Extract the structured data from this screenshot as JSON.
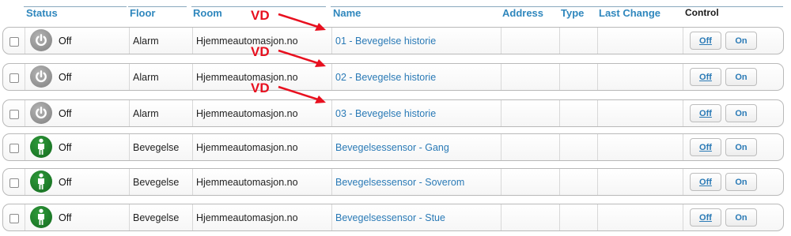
{
  "header": {
    "status": "Status",
    "floor": "Floor",
    "room": "Room",
    "name": "Name",
    "address": "Address",
    "type": "Type",
    "last_change": "Last Change",
    "control": "Control"
  },
  "annotation": {
    "label": "VD",
    "color": "#e8101f"
  },
  "rows": [
    {
      "status": "Off",
      "icon": "power-icon",
      "floor": "Alarm",
      "room": "Hjemmeautomasjon.no",
      "name": "01 - Bevegelse historie",
      "address": "",
      "type": "",
      "last_change": "",
      "off_label": "Off",
      "on_label": "On",
      "annotated": true
    },
    {
      "status": "Off",
      "icon": "power-icon",
      "floor": "Alarm",
      "room": "Hjemmeautomasjon.no",
      "name": "02 - Bevegelse historie",
      "address": "",
      "type": "",
      "last_change": "",
      "off_label": "Off",
      "on_label": "On",
      "annotated": true
    },
    {
      "status": "Off",
      "icon": "power-icon",
      "floor": "Alarm",
      "room": "Hjemmeautomasjon.no",
      "name": "03 - Bevegelse historie",
      "address": "",
      "type": "",
      "last_change": "",
      "off_label": "Off",
      "on_label": "On",
      "annotated": true
    },
    {
      "status": "Off",
      "icon": "person-icon",
      "floor": "Bevegelse",
      "room": "Hjemmeautomasjon.no",
      "name": "Bevegelsessensor - Gang",
      "address": "",
      "type": "",
      "last_change": "",
      "off_label": "Off",
      "on_label": "On",
      "annotated": false
    },
    {
      "status": "Off",
      "icon": "person-icon",
      "floor": "Bevegelse",
      "room": "Hjemmeautomasjon.no",
      "name": "Bevegelsessensor - Soverom",
      "address": "",
      "type": "",
      "last_change": "",
      "off_label": "Off",
      "on_label": "On",
      "annotated": false
    },
    {
      "status": "Off",
      "icon": "person-icon",
      "floor": "Bevegelse",
      "room": "Hjemmeautomasjon.no",
      "name": "Bevegelsessensor - Stue",
      "address": "",
      "type": "",
      "last_change": "",
      "off_label": "Off",
      "on_label": "On",
      "annotated": false
    }
  ],
  "colors": {
    "link": "#2a7ab6",
    "header": "#2f87bd",
    "active_green": "#1f7a2a",
    "inactive_gray": "#8a8a8a"
  }
}
